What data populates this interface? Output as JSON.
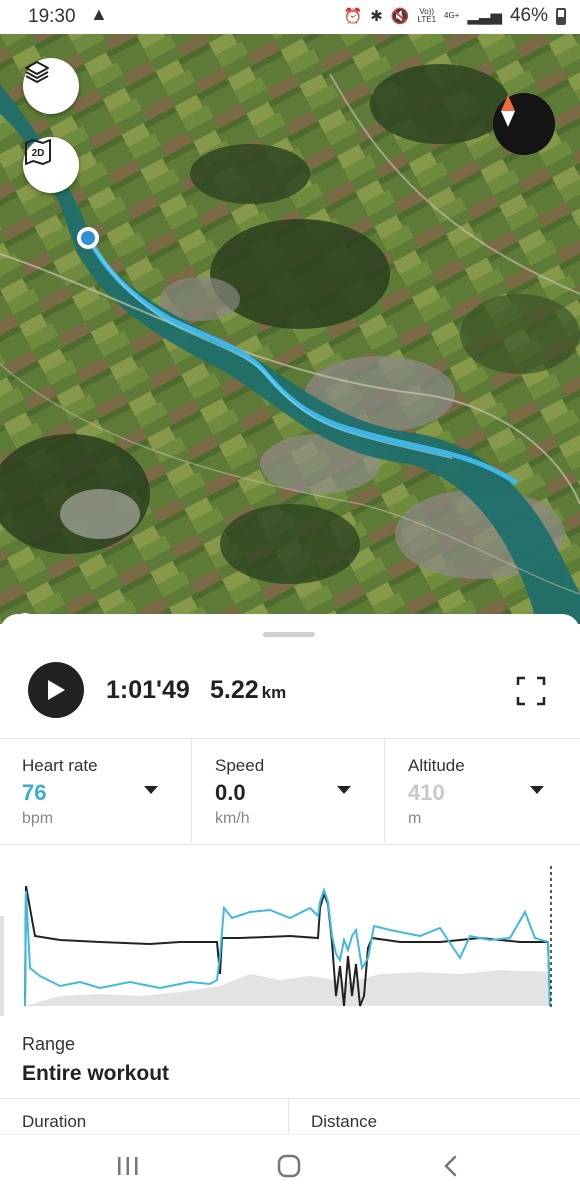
{
  "status_bar": {
    "time": "19:30",
    "network_label_top": "Vo))",
    "network_label_bottom": "LTE1",
    "network_type": "4G+",
    "battery_percent": "46%"
  },
  "map": {
    "attribution": "mapbox",
    "route_color": "#3fb6e6"
  },
  "workout": {
    "duration": "1:01'49",
    "distance_value": "5.22",
    "distance_unit": "km"
  },
  "metrics": [
    {
      "label": "Heart rate",
      "value": "76",
      "unit": "bpm",
      "color": "#3aabd2"
    },
    {
      "label": "Speed",
      "value": "0.0",
      "unit": "km/h",
      "color": "#222222"
    },
    {
      "label": "Altitude",
      "value": "410",
      "unit": "m",
      "color": "#c8c8c8"
    }
  ],
  "range": {
    "label": "Range",
    "value": "Entire workout"
  },
  "stats": {
    "duration_label": "Duration",
    "distance_label": "Distance"
  }
}
